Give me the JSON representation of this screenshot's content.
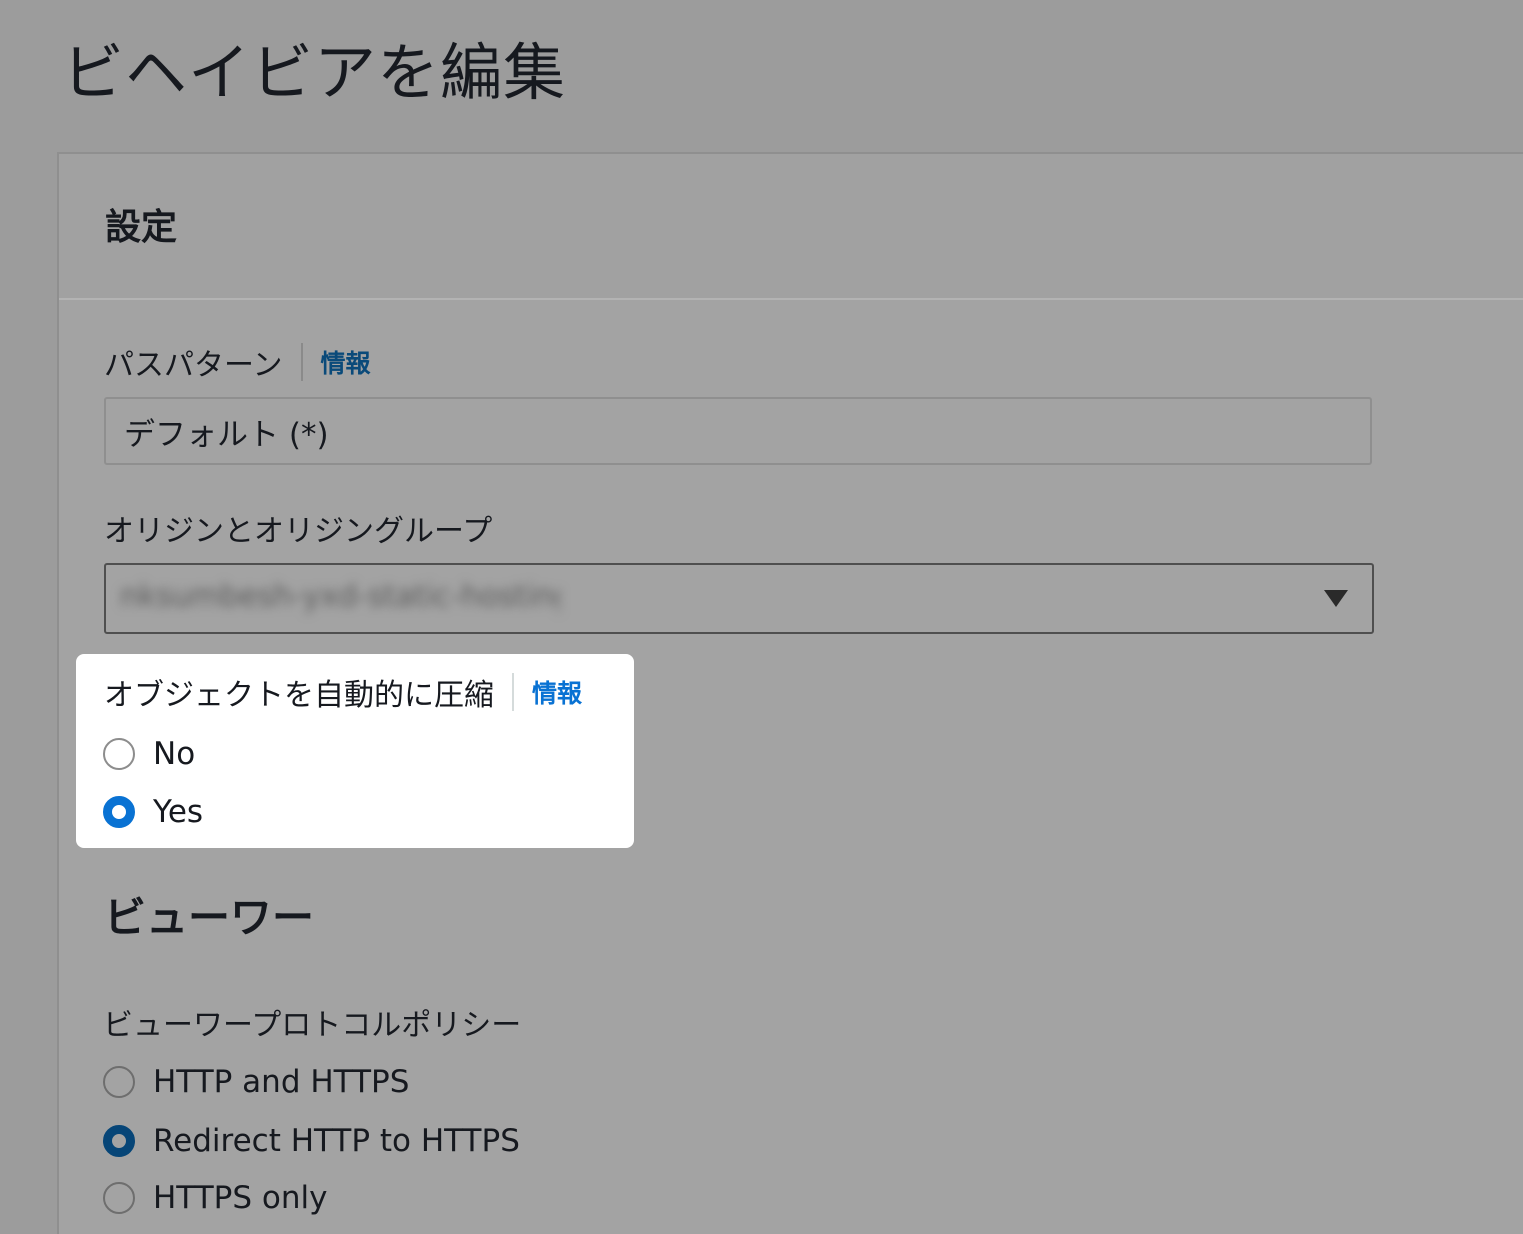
{
  "page": {
    "title": "ビヘイビアを編集"
  },
  "settings": {
    "title": "設定",
    "path_pattern": {
      "label": "パスパターン",
      "info": "情報",
      "value": "デフォルト (*)"
    },
    "origin": {
      "label": "オリジンとオリジングループ",
      "value": "nksumbesh-yxd-static-hosting"
    },
    "compress": {
      "label": "オブジェクトを自動的に圧縮",
      "info": "情報",
      "options": [
        "No",
        "Yes"
      ],
      "selected": "Yes"
    }
  },
  "viewer": {
    "title": "ビューワー",
    "protocol_policy": {
      "label": "ビューワープロトコルポリシー",
      "options": [
        "HTTP and HTTPS",
        "Redirect HTTP to HTTPS",
        "HTTPS only"
      ],
      "selected": "Redirect HTTP to HTTPS"
    }
  },
  "colors": {
    "accent": "#0972d3",
    "link": "#0a4a7a",
    "overlay_bg": "#9c9c9c",
    "highlight_bg": "#ffffff"
  }
}
